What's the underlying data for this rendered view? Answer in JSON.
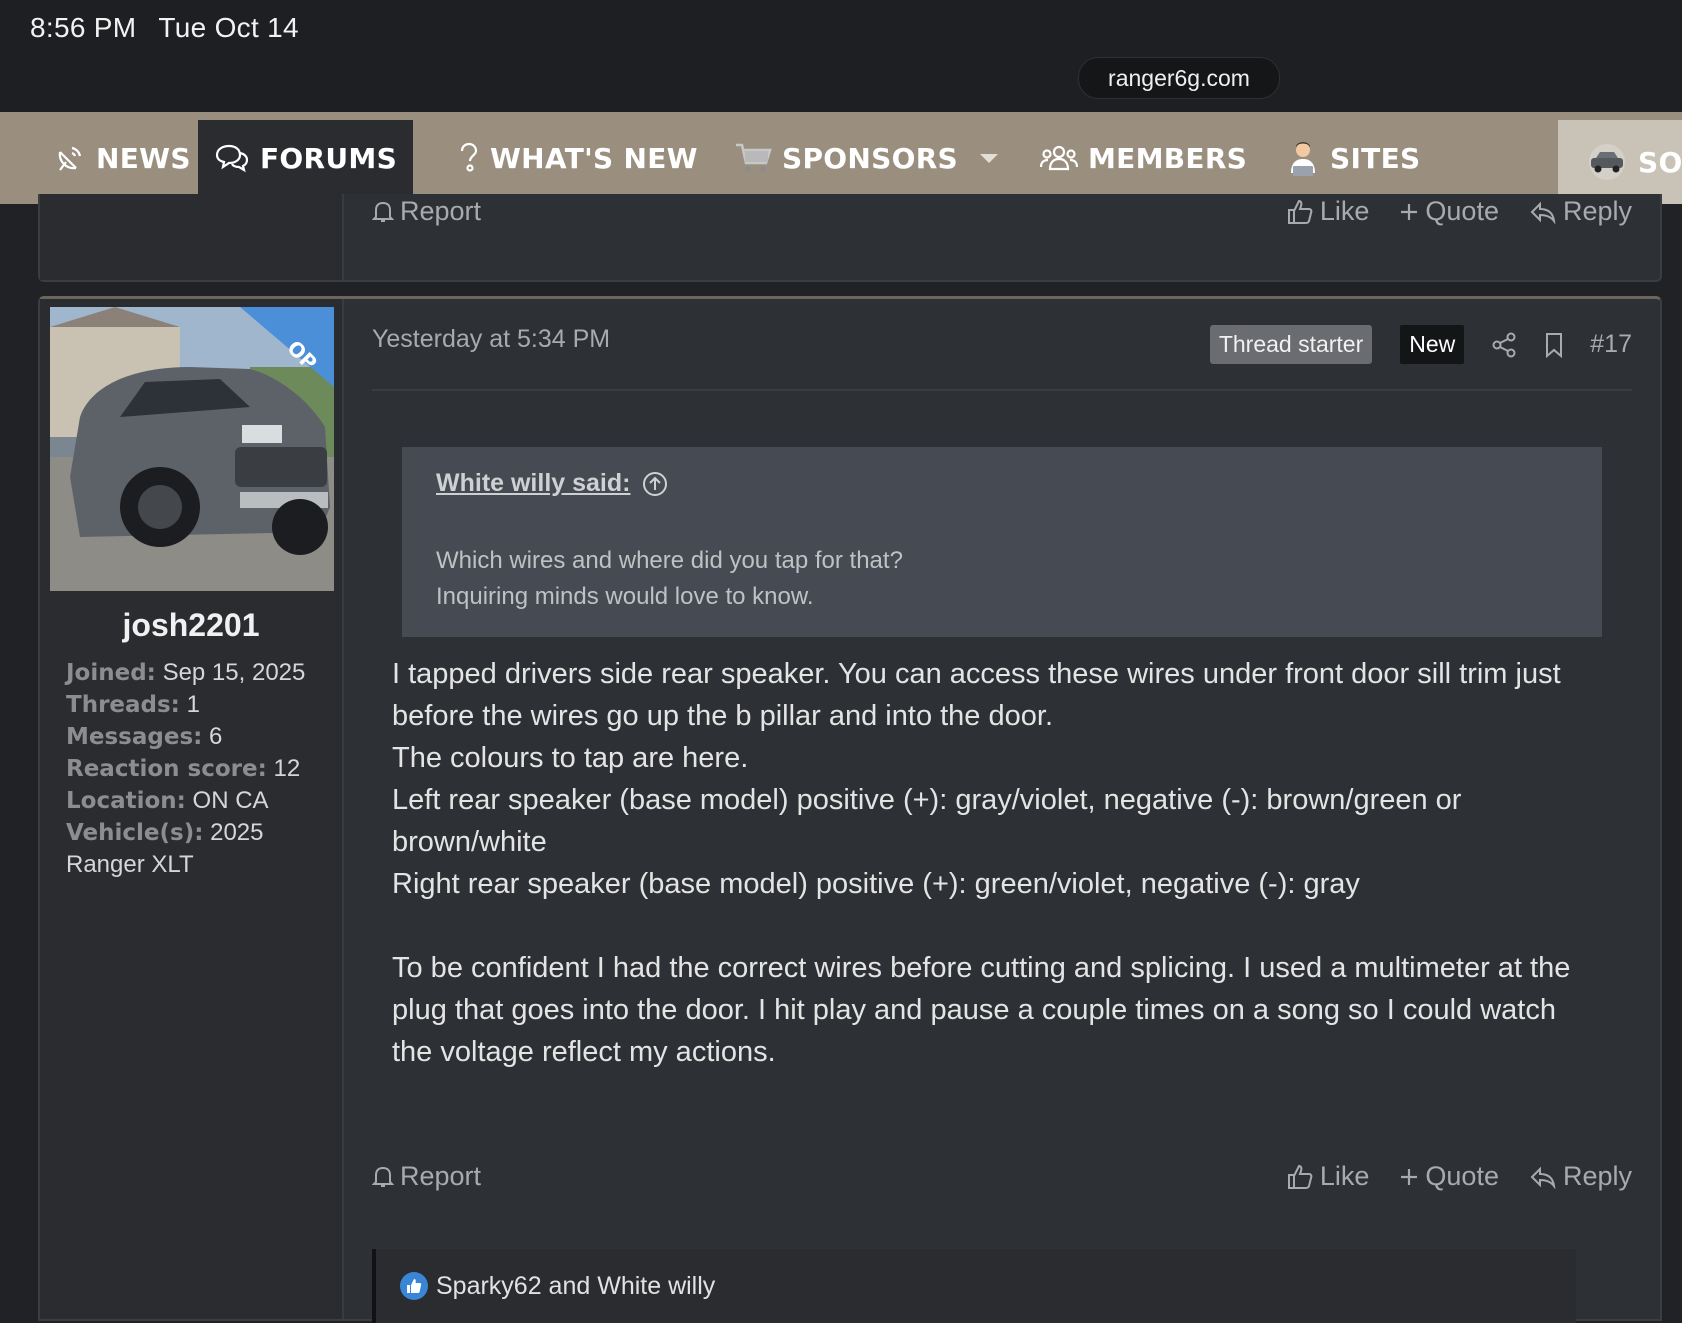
{
  "status_bar": {
    "time": "8:56 PM",
    "date": "Tue Oct 14"
  },
  "browser": {
    "url": "ranger6g.com"
  },
  "nav": {
    "items": [
      {
        "label": "NEWS",
        "icon": "satellite-dish-icon"
      },
      {
        "label": "FORUMS",
        "icon": "chat-bubbles-icon",
        "active": true
      },
      {
        "label": "WHAT'S NEW",
        "icon": "question-mark-icon"
      },
      {
        "label": "SPONSORS",
        "icon": "cart-icon"
      },
      {
        "label": "MEMBERS",
        "icon": "people-icon"
      },
      {
        "label": "SITES",
        "icon": "person-laptop-icon"
      },
      {
        "label": "SOU",
        "icon": "truck-thumbnail-icon"
      }
    ]
  },
  "prev_post": {
    "report_label": "Report",
    "like_label": "Like",
    "quote_label": "Quote",
    "reply_label": "Reply"
  },
  "post": {
    "author": {
      "username": "josh2201",
      "op_ribbon": "OP",
      "stats": [
        {
          "label": "Joined:",
          "value": "Sep 15, 2025"
        },
        {
          "label": "Threads:",
          "value": "1"
        },
        {
          "label": "Messages:",
          "value": "6"
        },
        {
          "label": "Reaction score:",
          "value": "12"
        },
        {
          "label": "Location:",
          "value": "ON CA"
        },
        {
          "label": "Vehicle(s):",
          "value": "2025 Ranger XLT"
        }
      ]
    },
    "timestamp": "Yesterday at 5:34 PM",
    "thread_starter_badge": "Thread starter",
    "new_badge": "New",
    "post_number": "#17",
    "quote": {
      "author": "White willy said:",
      "lines": [
        "Which wires and where did you tap for that?",
        "Inquiring minds would love to know."
      ]
    },
    "body": {
      "paragraph1": [
        "I tapped drivers side rear speaker. You can access these wires under front door sill trim just before the wires go up the b pillar and into the door.",
        "The colours to tap are here.",
        "Left rear speaker (base model) positive (+): gray/violet, negative (-): brown/green or brown/white",
        "Right rear speaker (base model) positive (+): green/violet, negative (-): gray"
      ],
      "paragraph2": "To be confident I had the correct wires before cutting and splicing. I used a multimeter at the plug that goes into the door. I hit play and pause a couple times on a song so I could watch the voltage reflect my actions."
    },
    "actions": {
      "report_label": "Report",
      "like_label": "Like",
      "quote_label": "Quote",
      "reply_label": "Reply"
    },
    "reactions": {
      "text": "Sparky62 and White willy",
      "icon": "thumbs-up-icon",
      "color": "#3a86d6"
    }
  },
  "colors": {
    "nav_bg": "#9a8f7f",
    "page_bg": "#202226",
    "post_bg": "#2d3034",
    "quote_bg": "#454a53"
  }
}
